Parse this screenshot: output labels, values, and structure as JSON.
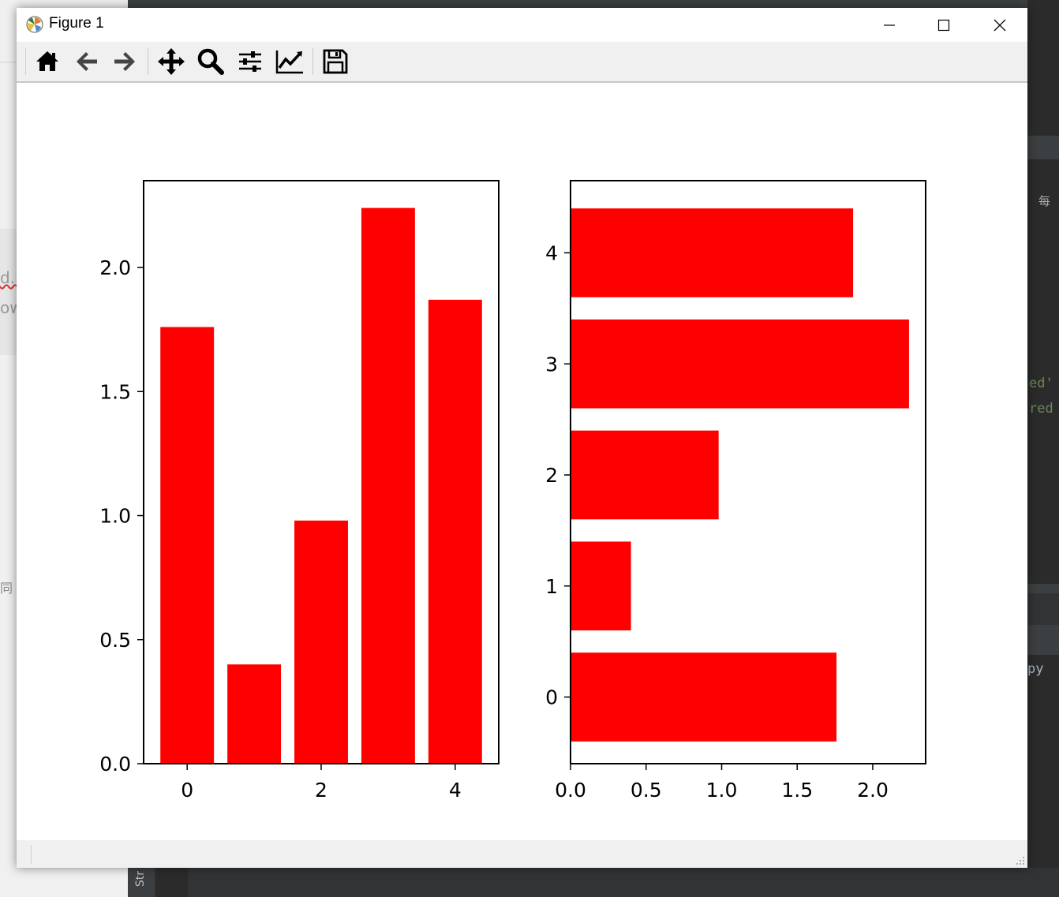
{
  "window": {
    "title": "Figure 1"
  },
  "toolbar": {
    "buttons": [
      {
        "name": "home-icon",
        "label": "Home"
      },
      {
        "name": "back-icon",
        "label": "Back"
      },
      {
        "name": "forward-icon",
        "label": "Forward"
      },
      {
        "name": "pan-icon",
        "label": "Pan"
      },
      {
        "name": "zoom-icon",
        "label": "Zoom"
      },
      {
        "name": "configure-subplots-icon",
        "label": "Subplots"
      },
      {
        "name": "edit-axis-icon",
        "label": "Customize"
      },
      {
        "name": "save-icon",
        "label": "Save"
      }
    ]
  },
  "colors": {
    "bar": "#ff0000",
    "axes": "#000000",
    "toolbar_bg": "#f0f0f0"
  },
  "background_fragments": {
    "left": [
      "d.r",
      "ow",
      "同"
    ],
    "right": [
      "每",
      "ed'",
      "red",
      "py"
    ]
  },
  "chart_data": [
    {
      "type": "bar",
      "orientation": "vertical",
      "x": [
        0,
        1,
        2,
        3,
        4
      ],
      "values": [
        1.76,
        0.4,
        0.98,
        2.24,
        1.87
      ],
      "xlim": [
        -0.65,
        4.65
      ],
      "ylim": [
        0,
        2.35
      ],
      "xticks": [
        0,
        2,
        4
      ],
      "xtick_labels": [
        "0",
        "2",
        "4"
      ],
      "yticks": [
        0,
        0.5,
        1,
        1.5,
        2
      ],
      "ytick_labels": [
        "0.0",
        "0.5",
        "1.0",
        "1.5",
        "2.0"
      ],
      "title": "",
      "xlabel": "",
      "ylabel": "",
      "grid": false
    },
    {
      "type": "bar",
      "orientation": "horizontal",
      "y": [
        0,
        1,
        2,
        3,
        4
      ],
      "values": [
        1.76,
        0.4,
        0.98,
        2.24,
        1.87
      ],
      "xlim": [
        0,
        2.35
      ],
      "ylim": [
        -0.6,
        4.65
      ],
      "xticks": [
        0,
        0.5,
        1,
        1.5,
        2
      ],
      "xtick_labels": [
        "0.0",
        "0.5",
        "1.0",
        "1.5",
        "2.0"
      ],
      "yticks": [
        0,
        1,
        2,
        3,
        4
      ],
      "ytick_labels": [
        "0",
        "1",
        "2",
        "3",
        "4"
      ],
      "title": "",
      "xlabel": "",
      "ylabel": "",
      "grid": false
    }
  ]
}
